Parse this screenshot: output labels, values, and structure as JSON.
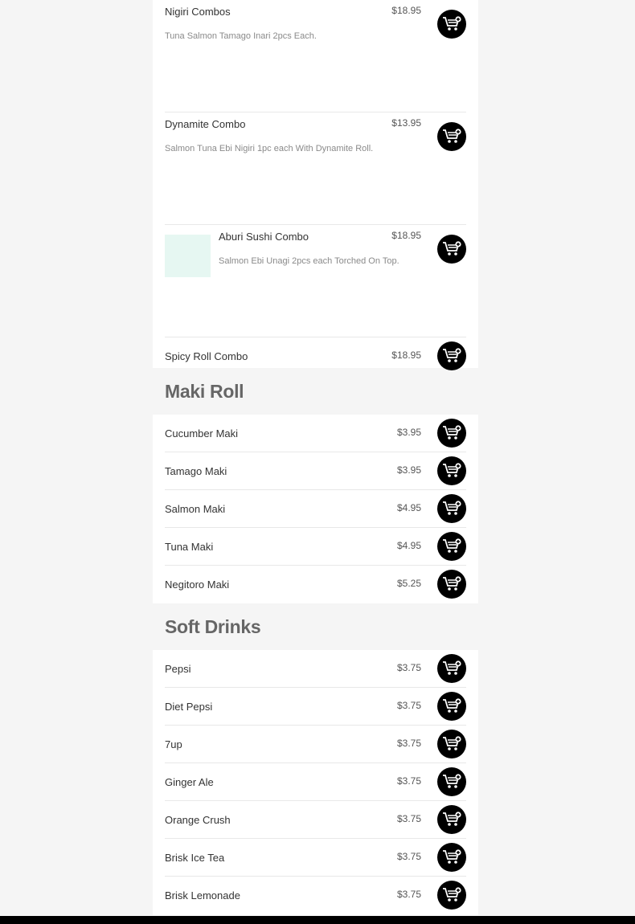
{
  "icons": {
    "add_to_cart": "cart-plus-icon",
    "button_color": "#000000"
  },
  "combos": [
    {
      "name": "Nigiri Combos",
      "description": "Tuna Salmon Tamago Inari 2pcs Each.",
      "price": "$18.95"
    },
    {
      "name": "Dynamite Combo",
      "description": "Salmon Tuna Ebi Nigiri 1pc each With Dynamite Roll.",
      "price": "$13.95"
    },
    {
      "name": "Aburi Sushi Combo",
      "description": "Salmon Ebi Unagi 2pcs each Torched On Top.",
      "price": "$18.95"
    },
    {
      "name": "Spicy Roll Combo",
      "price": "$18.95"
    }
  ],
  "maki_roll": {
    "title": "Maki Roll",
    "items": [
      {
        "name": "Cucumber Maki",
        "price": "$3.95"
      },
      {
        "name": "Tamago Maki",
        "price": "$3.95"
      },
      {
        "name": "Salmon Maki",
        "price": "$4.95"
      },
      {
        "name": "Tuna Maki",
        "price": "$4.95"
      },
      {
        "name": "Negitoro Maki",
        "price": "$5.25"
      }
    ]
  },
  "soft_drinks": {
    "title": "Soft Drinks",
    "items": [
      {
        "name": "Pepsi",
        "price": "$3.75"
      },
      {
        "name": "Diet Pepsi",
        "price": "$3.75"
      },
      {
        "name": "7up",
        "price": "$3.75"
      },
      {
        "name": "Ginger Ale",
        "price": "$3.75"
      },
      {
        "name": "Orange Crush",
        "price": "$3.75"
      },
      {
        "name": "Brisk Ice Tea",
        "price": "$3.75"
      },
      {
        "name": "Brisk Lemonade",
        "price": "$3.75"
      }
    ]
  }
}
